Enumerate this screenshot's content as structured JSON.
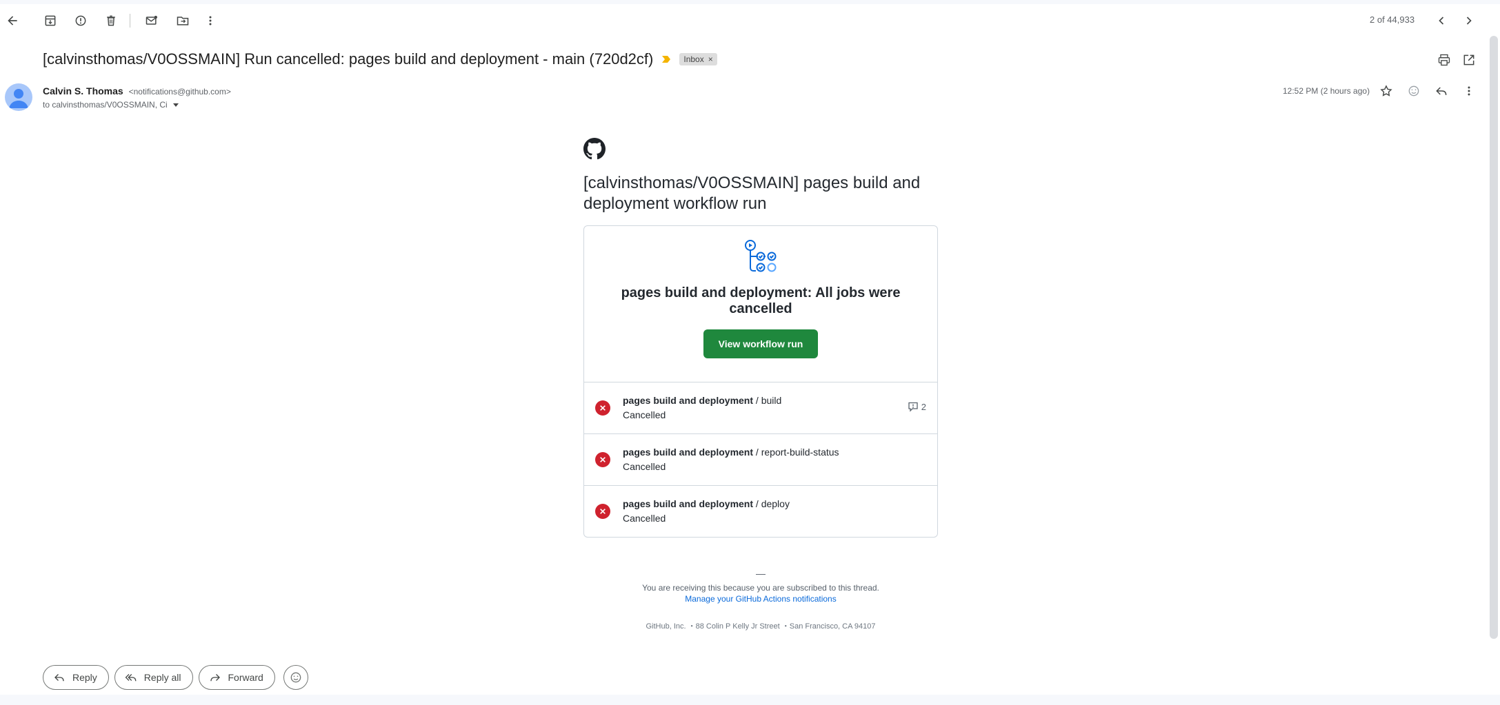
{
  "toolbar": {
    "icons": [
      "back-arrow-icon",
      "archive-icon",
      "report-spam-icon",
      "delete-icon",
      "mark-unread-icon",
      "move-to-icon",
      "more-vert-icon"
    ],
    "pager_text": "2 of 44,933"
  },
  "email": {
    "subject": "[calvinsthomas/V0OSSMAIN] Run cancelled: pages build and deployment - main (720d2cf)",
    "label": "Inbox",
    "label_remove": "×",
    "sender_name": "Calvin S. Thomas",
    "sender_email": "<notifications@github.com>",
    "to_line": "to calvinsthomas/V0OSSMAIN, Ci",
    "timestamp": "12:52 PM (2 hours ago)"
  },
  "body": {
    "title": "[calvinsthomas/V0OSSMAIN] pages build and deployment workflow run",
    "card_heading": "pages build and deployment: All jobs were cancelled",
    "cta_label": "View workflow run",
    "jobs": [
      {
        "name": "pages build and deployment",
        "sep": " / ",
        "step": "build",
        "status": "Cancelled",
        "annotation_count": "2"
      },
      {
        "name": "pages build and deployment",
        "sep": " / ",
        "step": "report-build-status",
        "status": "Cancelled"
      },
      {
        "name": "pages build and deployment",
        "sep": " / ",
        "step": "deploy",
        "status": "Cancelled"
      }
    ],
    "footer_dash": "—",
    "footer_reason": "You are receiving this because you are subscribed to this thread.",
    "footer_link": "Manage your GitHub Actions notifications",
    "footer_address": "GitHub, Inc. ・88 Colin P Kelly Jr Street ・San Francisco, CA 94107"
  },
  "actions": {
    "reply": "Reply",
    "reply_all": "Reply all",
    "forward": "Forward"
  },
  "colors": {
    "cta_green": "#1f883d",
    "error_red": "#cf222e",
    "link_blue": "#0969da",
    "importance_yellow": "#f4b400"
  }
}
